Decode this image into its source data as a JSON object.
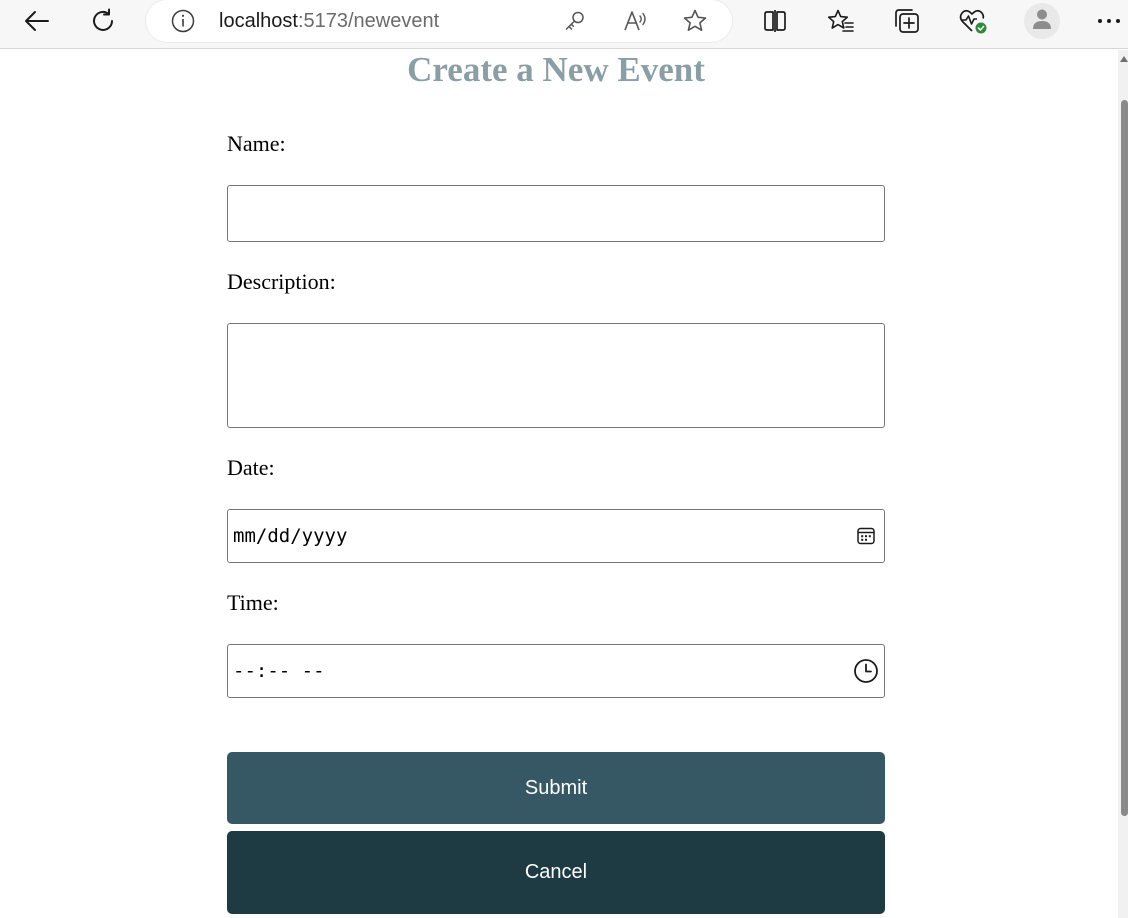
{
  "browser": {
    "url_host": "localhost",
    "url_path": ":5173/newevent"
  },
  "page": {
    "title": "Create a New Event"
  },
  "form": {
    "name_label": "Name:",
    "name_value": "",
    "description_label": "Description:",
    "description_value": "",
    "date_label": "Date:",
    "date_placeholder": "mm/dd/yyyy",
    "time_label": "Time:",
    "time_placeholder": "--:-- --",
    "submit_label": "Submit",
    "cancel_label": "Cancel"
  },
  "colors": {
    "title": "#8a9ea6",
    "submit_bg": "#365864",
    "cancel_bg": "#1e3a42"
  },
  "icons": {
    "back": "arrow-left-icon",
    "refresh": "refresh-icon",
    "site_info": "info-icon",
    "password": "key-icon",
    "read_aloud": "read-aloud-icon",
    "favorite": "star-icon",
    "split_screen": "split-screen-icon",
    "favorites_list": "favorites-icon",
    "collections": "collections-icon",
    "browser_essentials": "heart-pulse-icon",
    "profile": "profile-icon",
    "more": "more-icon",
    "date_picker": "calendar-icon",
    "time_picker": "clock-icon"
  }
}
